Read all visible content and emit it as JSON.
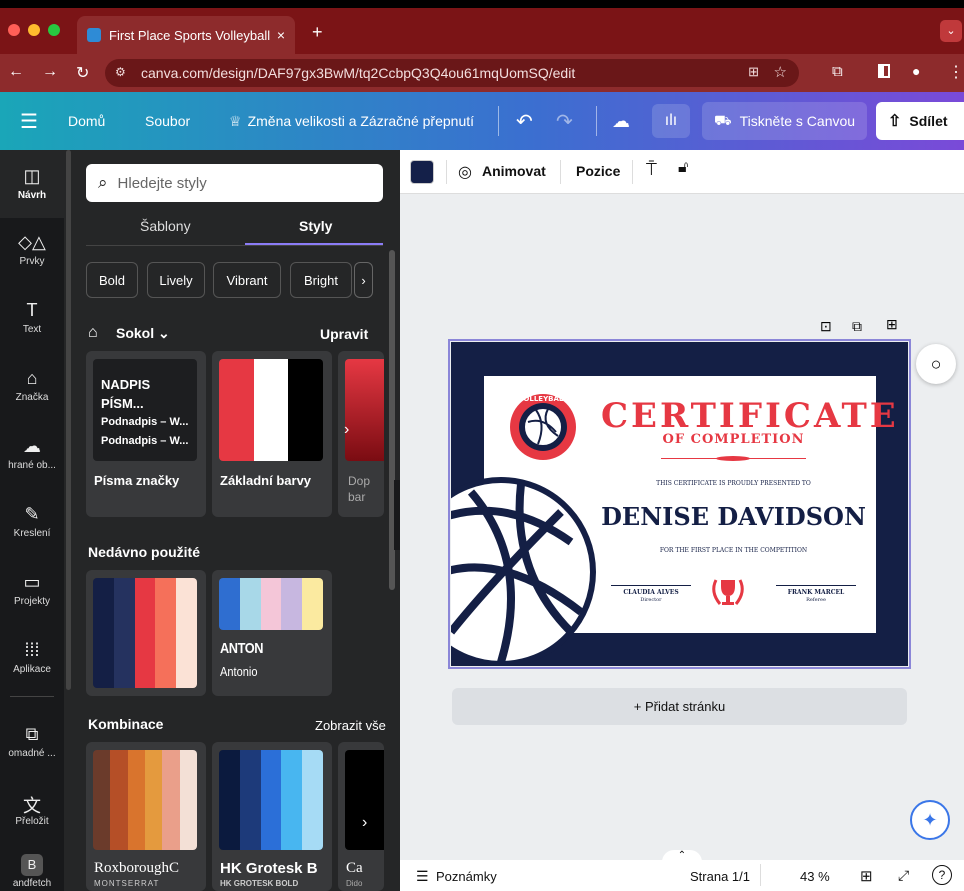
{
  "browser": {
    "tab_title": "First Place Sports Volleyball C",
    "url": "canva.com/design/DAF97gx3BwM/tq2CcbpQ3Q4ou61mqUomSQ/edit"
  },
  "header": {
    "home": "Domů",
    "file": "Soubor",
    "resize": "Změna velikosti a Zázračné přepnutí",
    "print": "Tiskněte s Canvou",
    "share": "Sdílet"
  },
  "rail": [
    {
      "label": "Návrh",
      "icon": "layout-icon"
    },
    {
      "label": "Prvky",
      "icon": "elements-icon"
    },
    {
      "label": "Text",
      "icon": "text-icon"
    },
    {
      "label": "Značka",
      "icon": "brand-icon"
    },
    {
      "label": "hrané ob...",
      "icon": "uploads-icon"
    },
    {
      "label": "Kreslení",
      "icon": "draw-icon"
    },
    {
      "label": "Projekty",
      "icon": "folder-icon"
    },
    {
      "label": "Aplikace",
      "icon": "apps-icon"
    },
    {
      "label": "omadné ...",
      "icon": "bulk-icon"
    },
    {
      "label": "Přeložit",
      "icon": "translate-icon"
    },
    {
      "label": "andfetch",
      "icon": "brandfetch-icon"
    }
  ],
  "panel": {
    "search_placeholder": "Hledejte styly",
    "tabs": [
      "Šablony",
      "Styly"
    ],
    "chips": [
      "Bold",
      "Lively",
      "Vibrant",
      "Bright"
    ],
    "kit_name": "Sokol",
    "edit": "Upravit",
    "brand_cards": {
      "fonts_label": "Písma značky",
      "fonts_lines": [
        "NADPIS PÍSM...",
        "Podnadpis – W...",
        "Podnadpis – W..."
      ],
      "colors_label": "Základní barvy",
      "third_label": "Dop bar"
    },
    "recent_title": "Nedávno použité",
    "recent_font_heading": "ANTON",
    "recent_font_sub": "Antonio",
    "combo_title": "Kombinace",
    "show_all": "Zobrazit vše",
    "combo_cards": [
      {
        "name": "RoxboroughC",
        "sub": "MONTSERRAT"
      },
      {
        "name": "HK Grotesk B",
        "sub": "HK GROTESK BOLD"
      },
      {
        "name": "Ca",
        "sub": "Dido"
      }
    ],
    "palettes": {
      "brand": [
        "#e63843",
        "#ffffff",
        "#000000"
      ],
      "recent": [
        "#141f45",
        "#25325f",
        "#e63843",
        "#f5705a",
        "#fbe2d6"
      ],
      "recent2": [
        "#2f6ed0",
        "#a8d8e8",
        "#f4c6d8",
        "#c7b7e0",
        "#fbeaa0"
      ],
      "combo1": [
        "#6b3b2b",
        "#b54f27",
        "#d9742d",
        "#e49a3e",
        "#ea9f8a",
        "#f3e0d6"
      ],
      "combo2": [
        "#0b1a3e",
        "#1d3a7a",
        "#2b6fd8",
        "#48b6f0",
        "#a6dbf5"
      ]
    }
  },
  "toolbar": {
    "animate": "Animovat",
    "position": "Pozice",
    "color": "#142049"
  },
  "certificate": {
    "title": "CERTIFICATE",
    "subtitle": "OF COMPLETION",
    "presented": "THIS CERTIFICATE IS PROUDLY PRESENTED TO",
    "name": "DENISE DAVIDSON",
    "reason": "FOR THE FIRST PLACE IN THE COMPETITION",
    "sig1_name": "CLAUDIA ALVES",
    "sig1_role": "Director",
    "sig2_name": "FRANK MARCEL",
    "sig2_role": "Referee",
    "badge_top": "VOLLEYBALL",
    "badge_bottom": "VOLLEYBALL",
    "accent": "#e63843",
    "navy": "#141f45"
  },
  "add_page": "+ Přidat stránku",
  "bottom": {
    "notes": "Poznámky",
    "page": "Strana 1/1",
    "zoom": "43 %"
  }
}
